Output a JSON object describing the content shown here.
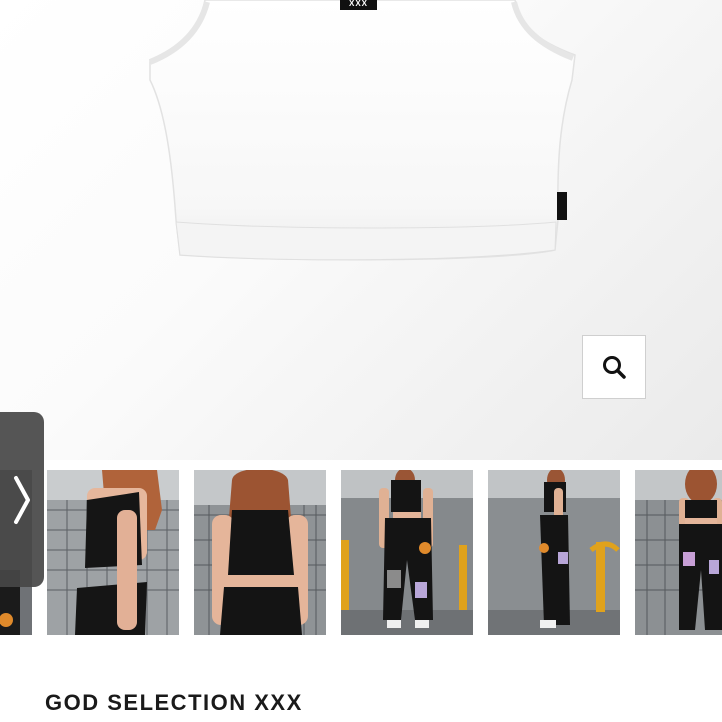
{
  "product": {
    "brand": "GOD SELECTION XXX",
    "main_image_label": "white sleeveless crop top",
    "tag_text": "XXX"
  },
  "gallery": {
    "thumbnails": [
      {
        "alt": "model side view black crop top"
      },
      {
        "alt": "model back view black crop top"
      },
      {
        "alt": "model front view black pants with patches"
      },
      {
        "alt": "model side view black pants with patches"
      },
      {
        "alt": "model back view black pants"
      }
    ]
  },
  "icons": {
    "zoom": "search-icon",
    "prev": "chevron-right-icon"
  },
  "colors": {
    "background": "#ffffff",
    "arrow_bg": "#464646",
    "text": "#1a1a1a"
  }
}
